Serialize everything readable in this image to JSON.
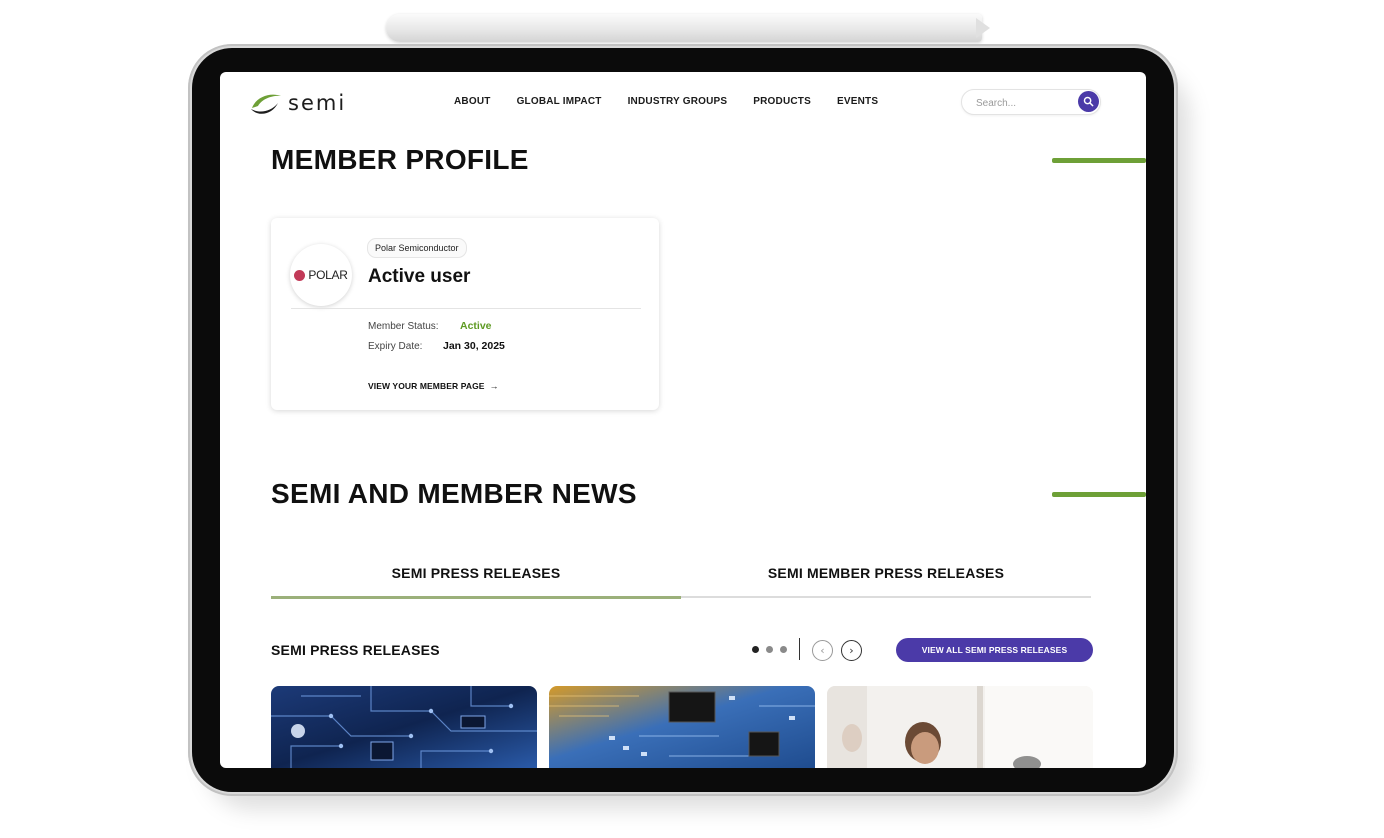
{
  "brand": {
    "logo_text": "semi",
    "green": "#6ea037",
    "purple": "#4b3aa8"
  },
  "nav": {
    "items": [
      "ABOUT",
      "GLOBAL IMPACT",
      "INDUSTRY GROUPS",
      "PRODUCTS",
      "EVENTS"
    ]
  },
  "search": {
    "placeholder": "Search...",
    "icon": "search-icon"
  },
  "member_profile": {
    "heading": "MEMBER PROFILE",
    "card": {
      "logo_text": "POLAR",
      "org_name": "Polar Semiconductor",
      "title": "Active user",
      "status_label": "Member Status:",
      "status_value": "Active",
      "expiry_label": "Expiry Date:",
      "expiry_value": "Jan 30, 2025",
      "link_label": "VIEW YOUR MEMBER PAGE",
      "link_icon": "arrow-right-icon"
    }
  },
  "news": {
    "heading": "SEMI AND MEMBER NEWS",
    "tabs": [
      "SEMI PRESS RELEASES",
      "SEMI MEMBER PRESS RELEASES"
    ],
    "active_tab_index": 0,
    "section_title": "SEMI PRESS RELEASES",
    "carousel": {
      "pages": 3,
      "active_page": 1,
      "prev_icon": "chevron-left-icon",
      "next_icon": "chevron-right-icon"
    },
    "view_all_label": "VIEW ALL SEMI PRESS RELEASES",
    "thumbnails": [
      "circuit-board-blue-image",
      "circuit-board-chip-image",
      "people-meeting-image"
    ]
  }
}
